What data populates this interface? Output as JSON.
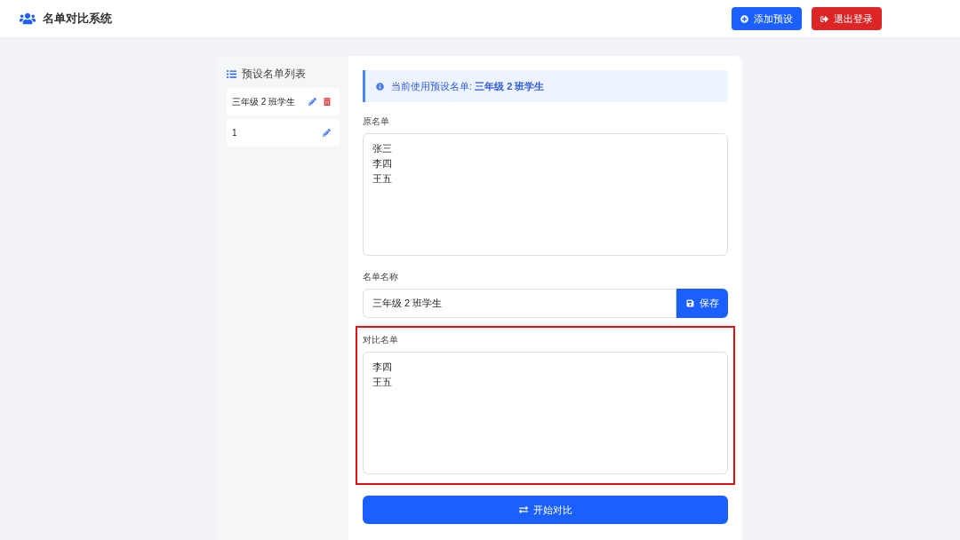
{
  "header": {
    "title": "名单对比系统",
    "buttons": [
      {
        "kind": "add",
        "label": "添加预设"
      },
      {
        "kind": "logout",
        "label": "退出登录"
      }
    ]
  },
  "sidebar": {
    "title": "预设名单列表",
    "items": [
      {
        "name": "三年级 2 班学生",
        "deletable": true
      },
      {
        "name": "1",
        "deletable": false
      }
    ]
  },
  "notice": {
    "text": "当前使用预设名单: **三年级 2 班学生**"
  },
  "original_list": {
    "label": "原名单",
    "lines": [
      "张三",
      "李四",
      "王五"
    ],
    "highlighted": false
  },
  "list_name": {
    "label": "名单名称",
    "value": "三年级 2 班学生",
    "button": "保存"
  },
  "compare_list": {
    "label": "对比名单",
    "lines": [
      "李四",
      "王五"
    ],
    "highlighted": true
  },
  "compare_button": "开始对比"
}
